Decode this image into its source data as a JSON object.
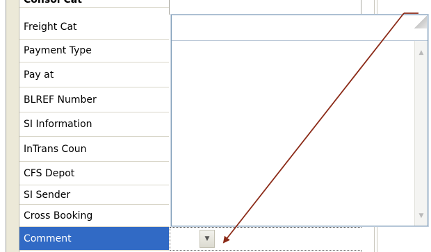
{
  "property_grid": {
    "top_row_partial": "Consol Cat",
    "rows": [
      {
        "label": "Freight Cat"
      },
      {
        "label": "Payment Type"
      },
      {
        "label": "Pay at"
      },
      {
        "label": "BLREF Number"
      },
      {
        "label": "SI Information"
      },
      {
        "label": "InTrans Coun"
      },
      {
        "label": "CFS Depot"
      },
      {
        "label": "SI Sender"
      },
      {
        "label": "Cross Booking"
      },
      {
        "label": "Comment"
      }
    ],
    "selected_row": "Comment"
  },
  "dropdown": {
    "text_value": "",
    "list_items": []
  },
  "colors": {
    "selection": "#316ac5",
    "arrow": "#8b2a17",
    "grid_line": "#d8d5c8"
  },
  "icons": {
    "scroll_up": "▲",
    "scroll_down": "▼",
    "combo_dropdown": "▼"
  }
}
